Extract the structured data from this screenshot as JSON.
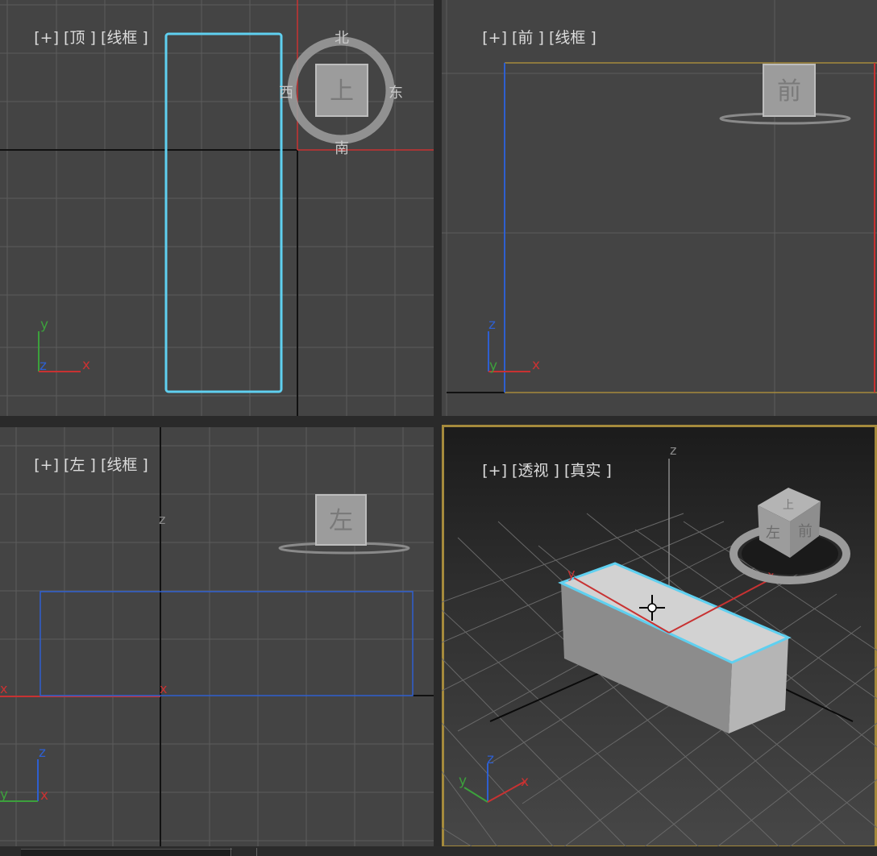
{
  "viewports": {
    "top": {
      "label": {
        "plus": "[+]",
        "view": "[顶 ]",
        "shading": "[线框 ]"
      },
      "viewcube": {
        "face": "上",
        "north": "北",
        "south": "南",
        "east": "东",
        "west": "西"
      },
      "axis_labels": {
        "y": "y",
        "z": "z",
        "x": "x"
      }
    },
    "front": {
      "label": {
        "plus": "[+]",
        "view": "[前 ]",
        "shading": "[线框 ]"
      },
      "viewcube": {
        "face": "前"
      },
      "axis_labels": {
        "z": "z",
        "y": "y",
        "x": "x"
      }
    },
    "left": {
      "label": {
        "plus": "[+]",
        "view": "[左 ]",
        "shading": "[线框 ]"
      },
      "viewcube": {
        "face": "左"
      },
      "axis_labels": {
        "z": "z",
        "y": "y",
        "x": "x"
      },
      "pivot_labels": {
        "z": "z",
        "x": "x"
      }
    },
    "perspective": {
      "label": {
        "plus": "[+]",
        "view": "[透视 ]",
        "shading": "[真实 ]"
      },
      "viewcube": {
        "face_front": "前",
        "face_left": "左",
        "face_top": "上"
      },
      "axis_labels": {
        "z": "z",
        "y": "y",
        "x": "x"
      },
      "gizmo_labels": {
        "z": "z",
        "y": "y",
        "x": "x"
      },
      "active": true
    }
  },
  "colors": {
    "viewport_bg": "#444444",
    "grid": "#5c5c5c",
    "selection": "#5fd0f0",
    "axis_x": "#c83232",
    "axis_y": "#3ca03c",
    "axis_z": "#2e5fd0",
    "active_border": "#a58a3c",
    "object_wire": "#2e5fd0",
    "gold_outline": "#a58a3c"
  }
}
